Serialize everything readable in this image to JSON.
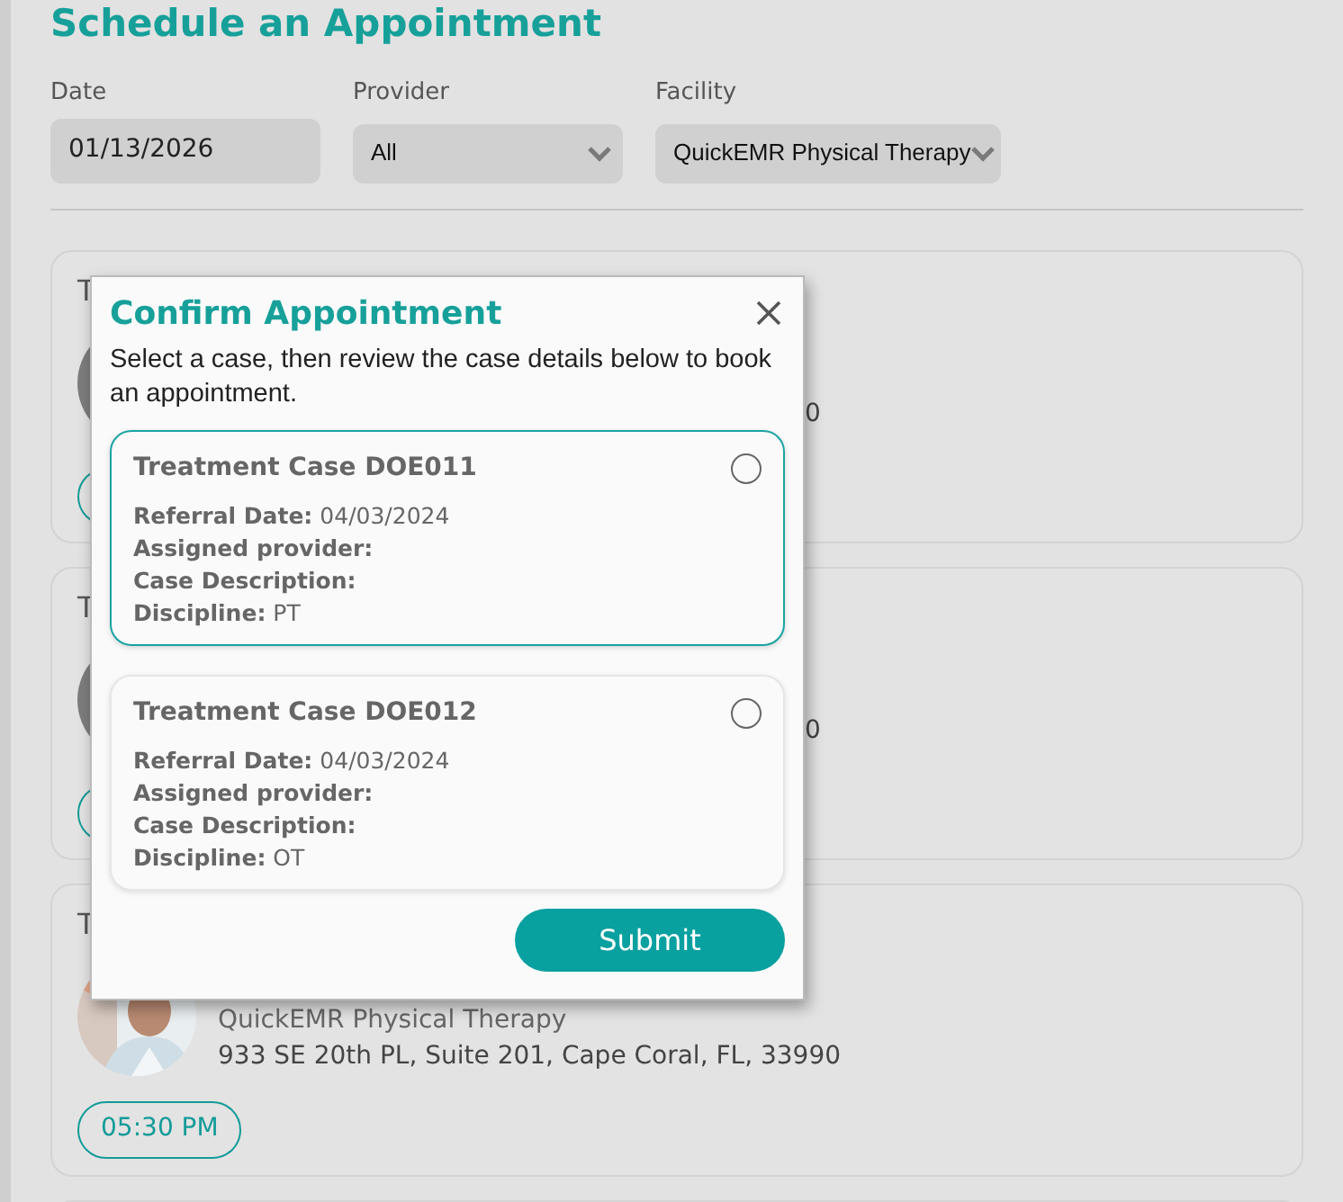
{
  "page": {
    "title": "Schedule an Appointment"
  },
  "filters": [
    {
      "label": "Date",
      "kind": "date",
      "value": "01/13/2026"
    },
    {
      "label": "Provider",
      "kind": "select",
      "value": "All"
    },
    {
      "label": "Facility",
      "kind": "select",
      "value": "QuickEMR Physical Therapy"
    }
  ],
  "appointments": [
    {
      "title": "T",
      "kind": "placeholder",
      "address": "0"
    },
    {
      "title": "T",
      "kind": "placeholder",
      "address": "0"
    },
    {
      "title": "T",
      "kind": "picture",
      "facility": "QuickEMR Physical Therapy",
      "address": "933 SE 20th PL, Suite 201, Cape Coral, FL, 33990",
      "time": "05:30 PM"
    }
  ],
  "dialog": {
    "title": "Confirm Appointment",
    "message": "Select a case, then review the case details below to book an appointment.",
    "cases": [
      {
        "title": "Treatment Case DOE011",
        "selected": false,
        "focused": true,
        "fields": [
          {
            "label": "Referral Date:",
            "value": "04/03/2024"
          },
          {
            "label": "Assigned provider:"
          },
          {
            "label": "Case Description:"
          },
          {
            "label": "Discipline:",
            "value": "PT"
          }
        ]
      },
      {
        "title": "Treatment Case DOE012",
        "selected": false,
        "focused": false,
        "fields": [
          {
            "label": "Referral Date:",
            "value": "04/03/2024"
          },
          {
            "label": "Assigned provider:"
          },
          {
            "label": "Case Description:"
          },
          {
            "label": "Discipline:",
            "value": "OT"
          }
        ]
      }
    ],
    "submit": "Submit"
  }
}
